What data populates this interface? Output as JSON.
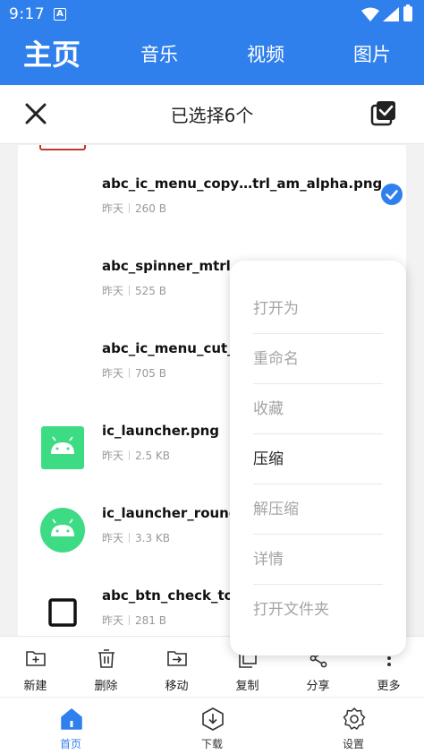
{
  "status_bar": {
    "time": "9:17",
    "notification_letter": "A"
  },
  "top_tabs": [
    {
      "label": "主页",
      "active": true
    },
    {
      "label": "音乐",
      "active": false
    },
    {
      "label": "视频",
      "active": false
    },
    {
      "label": "图片",
      "active": false
    }
  ],
  "selection_bar": {
    "title": "已选择6个"
  },
  "files": [
    {
      "name": "abc_ic_menu_copy…trl_am_alpha.png",
      "date": "昨天",
      "size": "260 B",
      "selected": true
    },
    {
      "name": "abc_spinner_mtrl_",
      "date": "昨天",
      "size": "525 B",
      "selected": false
    },
    {
      "name": "abc_ic_menu_cut_",
      "date": "昨天",
      "size": "705 B",
      "selected": false
    },
    {
      "name": "ic_launcher.png",
      "date": "昨天",
      "size": "2.5 KB",
      "selected": false
    },
    {
      "name": "ic_launcher_round",
      "date": "昨天",
      "size": "3.3 KB",
      "selected": false
    },
    {
      "name": "abc_btn_check_to_",
      "date": "昨天",
      "size": "281 B",
      "selected": false
    }
  ],
  "popup_menu": [
    {
      "label": "打开为",
      "enabled": false
    },
    {
      "label": "重命名",
      "enabled": false
    },
    {
      "label": "收藏",
      "enabled": false
    },
    {
      "label": "压缩",
      "enabled": true
    },
    {
      "label": "解压缩",
      "enabled": false
    },
    {
      "label": "详情",
      "enabled": false
    },
    {
      "label": "打开文件夹",
      "enabled": false
    }
  ],
  "actions": [
    {
      "label": "新建",
      "icon": "new-folder-icon"
    },
    {
      "label": "删除",
      "icon": "trash-icon"
    },
    {
      "label": "移动",
      "icon": "move-folder-icon"
    },
    {
      "label": "复制",
      "icon": "copy-icon"
    },
    {
      "label": "分享",
      "icon": "share-icon"
    },
    {
      "label": "更多",
      "icon": "more-icon"
    }
  ],
  "bottom_nav": [
    {
      "label": "首页",
      "icon": "home-icon",
      "active": true
    },
    {
      "label": "下载",
      "icon": "download-icon",
      "active": false
    },
    {
      "label": "设置",
      "icon": "settings-icon",
      "active": false
    }
  ],
  "colors": {
    "primary": "#2f80ed",
    "android_green": "#3ddc84",
    "disabled_text": "#a5a5a5"
  }
}
